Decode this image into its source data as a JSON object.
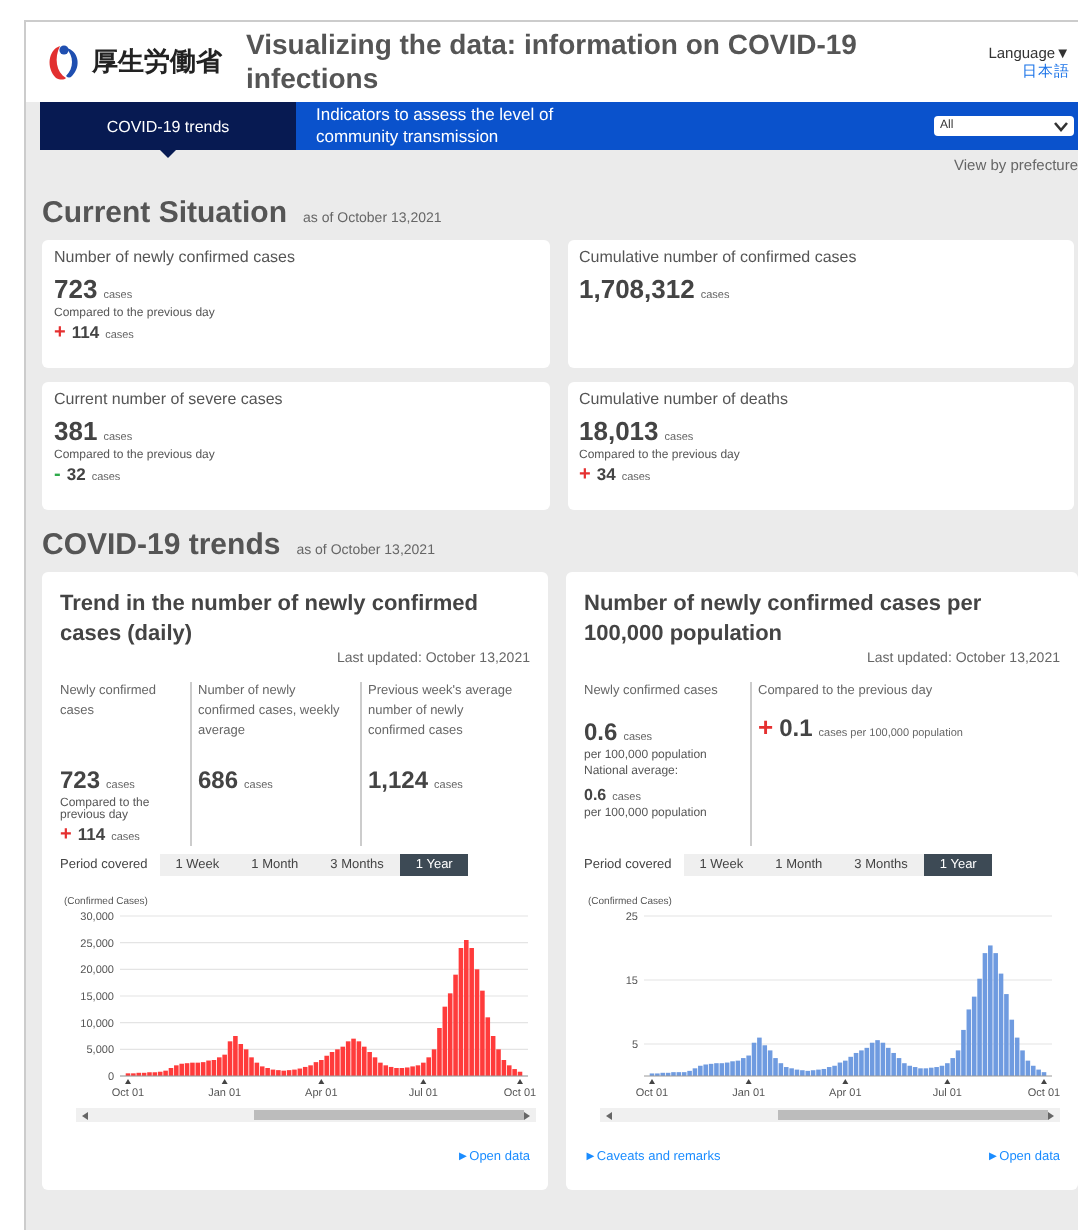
{
  "header": {
    "logo_text": "厚生労働省",
    "title": "Visualizing the data: information on COVID-19 infections",
    "language_label": "Language▼",
    "language_link": "日本語"
  },
  "nav": {
    "tabs": [
      {
        "label": "COVID-19 trends",
        "selected": true
      },
      {
        "label": "Indicators to assess the level of community transmission",
        "selected": false
      }
    ],
    "select_value": "All",
    "link": "View by prefecture"
  },
  "current": {
    "title": "Current Situation",
    "as_of": "as of October 13,2021",
    "cards": [
      {
        "label": "Number of newly confirmed cases",
        "value": "723",
        "unit": "cases",
        "compare_label": "Compared to the previous day",
        "sign": "+",
        "color": "#e53030",
        "change": "114",
        "change_unit": "cases"
      },
      {
        "label": "Cumulative number of confirmed cases",
        "value": "1,708,312",
        "unit": "cases"
      },
      {
        "label": "Current number of severe cases",
        "value": "381",
        "unit": "cases",
        "compare_label": "Compared to the previous day",
        "sign": "-",
        "color": "#2eaa4a",
        "change": "32",
        "change_unit": "cases"
      },
      {
        "label": "Cumulative number of deaths",
        "value": "18,013",
        "unit": "cases",
        "compare_label": "Compared to the previous day",
        "sign": "+",
        "color": "#e53030",
        "change": "34",
        "change_unit": "cases"
      }
    ]
  },
  "trends": {
    "title": "COVID-19 trends",
    "as_of": "as of October 13,2021",
    "panels": [
      {
        "title": "Trend in the number of newly confirmed cases (daily)",
        "updated": "Last updated: October 13,2021",
        "stats": [
          {
            "kind": "count",
            "label": "Newly confirmed cases",
            "value": "723",
            "unit": "cases",
            "compare_label": "Compared to the previous day",
            "sign": "+",
            "color": "#e53030",
            "change": "114",
            "change_unit": "cases"
          },
          {
            "kind": "count",
            "label": "Number of newly confirmed cases, weekly average",
            "value": "686",
            "unit": "cases"
          },
          {
            "kind": "count",
            "label": "Previous week's average number of newly confirmed cases",
            "value": "1,124",
            "unit": "cases"
          }
        ],
        "period_label": "Period covered",
        "periods": [
          {
            "label": "1 Week",
            "selected": false
          },
          {
            "label": "1 Month",
            "selected": false
          },
          {
            "label": "3 Months",
            "selected": false
          },
          {
            "label": "1 Year",
            "selected": true
          }
        ],
        "chart_data": {
          "type": "bar",
          "grid": true,
          "ylabel": "(Confirmed Cases)",
          "ylim": [
            0,
            30000
          ],
          "yticks": [
            {
              "value": 0,
              "label": "0"
            },
            {
              "value": 5000,
              "label": "5,000"
            },
            {
              "value": 10000,
              "label": "10,000"
            },
            {
              "value": 15000,
              "label": "15,000"
            },
            {
              "value": 20000,
              "label": "20,000"
            },
            {
              "value": 25000,
              "label": "25,000"
            },
            {
              "value": 30000,
              "label": "30,000"
            }
          ],
          "categories": [
            "Oct 01",
            null,
            null,
            null,
            null,
            null,
            null,
            null,
            null,
            null,
            null,
            null,
            null,
            null,
            null,
            null,
            null,
            null,
            "Jan 01",
            null,
            null,
            null,
            null,
            null,
            null,
            null,
            null,
            null,
            null,
            null,
            null,
            null,
            null,
            null,
            null,
            null,
            "Apr 01",
            null,
            null,
            null,
            null,
            null,
            null,
            null,
            null,
            null,
            null,
            null,
            null,
            null,
            null,
            null,
            null,
            null,
            null,
            "Jul 01",
            null,
            null,
            null,
            null,
            null,
            null,
            null,
            null,
            null,
            null,
            null,
            null,
            null,
            null,
            null,
            null,
            null,
            "Oct 01"
          ],
          "series": [
            {
              "color": "#ff3b3b",
              "values": [
                500,
                500,
                600,
                600,
                700,
                700,
                800,
                1000,
                1500,
                2000,
                2300,
                2400,
                2500,
                2500,
                2600,
                2900,
                3000,
                3500,
                4000,
                6500,
                7500,
                6000,
                5000,
                3500,
                2500,
                1800,
                1500,
                1200,
                1100,
                1000,
                1100,
                1200,
                1400,
                1700,
                2000,
                2600,
                3000,
                3800,
                4500,
                5000,
                5500,
                6500,
                7000,
                6500,
                5500,
                4500,
                3500,
                2500,
                2000,
                1700,
                1500,
                1500,
                1600,
                1800,
                2000,
                2500,
                3500,
                5000,
                9000,
                13000,
                15500,
                19000,
                24000,
                25500,
                24000,
                20000,
                16000,
                11000,
                7500,
                5000,
                3000,
                2000,
                1300,
                800
              ]
            }
          ]
        },
        "links": [
          "►Open data"
        ]
      },
      {
        "title": "Number of newly confirmed cases per 100,000 population",
        "updated": "Last updated: October 13,2021",
        "stats": [
          {
            "kind": "rate",
            "label": "Newly confirmed cases",
            "value": "0.6",
            "unit": "cases",
            "per": "per 100,000 population",
            "avg_label": "National average:",
            "avg_value": "0.6",
            "avg_unit": "cases",
            "avg_per": "per 100,000 population"
          },
          {
            "kind": "delta",
            "label": "Compared to the previous day",
            "sign": "+",
            "color": "#e53030",
            "value": "0.1",
            "unit": "cases per 100,000 population"
          }
        ],
        "period_label": "Period covered",
        "periods": [
          {
            "label": "1 Week",
            "selected": false
          },
          {
            "label": "1 Month",
            "selected": false
          },
          {
            "label": "3 Months",
            "selected": false
          },
          {
            "label": "1 Year",
            "selected": true
          }
        ],
        "chart_data": {
          "type": "bar",
          "grid": true,
          "ylabel": "(Confirmed Cases)",
          "ylim": [
            0,
            25
          ],
          "yticks": [
            5,
            15,
            25
          ],
          "categories": [
            "Oct 01",
            null,
            null,
            null,
            null,
            null,
            null,
            null,
            null,
            null,
            null,
            null,
            null,
            null,
            null,
            null,
            null,
            null,
            "Jan 01",
            null,
            null,
            null,
            null,
            null,
            null,
            null,
            null,
            null,
            null,
            null,
            null,
            null,
            null,
            null,
            null,
            null,
            "Apr 01",
            null,
            null,
            null,
            null,
            null,
            null,
            null,
            null,
            null,
            null,
            null,
            null,
            null,
            null,
            null,
            null,
            null,
            null,
            "Jul 01",
            null,
            null,
            null,
            null,
            null,
            null,
            null,
            null,
            null,
            null,
            null,
            null,
            null,
            null,
            null,
            null,
            null,
            "Oct 01"
          ],
          "series": [
            {
              "color": "#6f9be0",
              "values": [
                0.4,
                0.4,
                0.5,
                0.5,
                0.6,
                0.6,
                0.6,
                0.8,
                1.2,
                1.6,
                1.8,
                1.9,
                2.0,
                2.0,
                2.1,
                2.3,
                2.4,
                2.8,
                3.2,
                5.2,
                6.0,
                4.8,
                4.0,
                2.8,
                2.0,
                1.4,
                1.2,
                1.0,
                0.9,
                0.8,
                0.9,
                1.0,
                1.1,
                1.4,
                1.6,
                2.1,
                2.4,
                3.0,
                3.6,
                4.0,
                4.4,
                5.2,
                5.6,
                5.2,
                4.4,
                3.6,
                2.8,
                2.0,
                1.6,
                1.4,
                1.2,
                1.2,
                1.3,
                1.4,
                1.6,
                2.0,
                2.8,
                4.0,
                7.2,
                10.4,
                12.4,
                15.2,
                19.2,
                20.4,
                19.2,
                16.0,
                12.8,
                8.8,
                6.0,
                4.0,
                2.4,
                1.6,
                1.0,
                0.6
              ]
            }
          ]
        },
        "links": [
          "►Caveats and remarks",
          "►Open data"
        ]
      }
    ]
  }
}
